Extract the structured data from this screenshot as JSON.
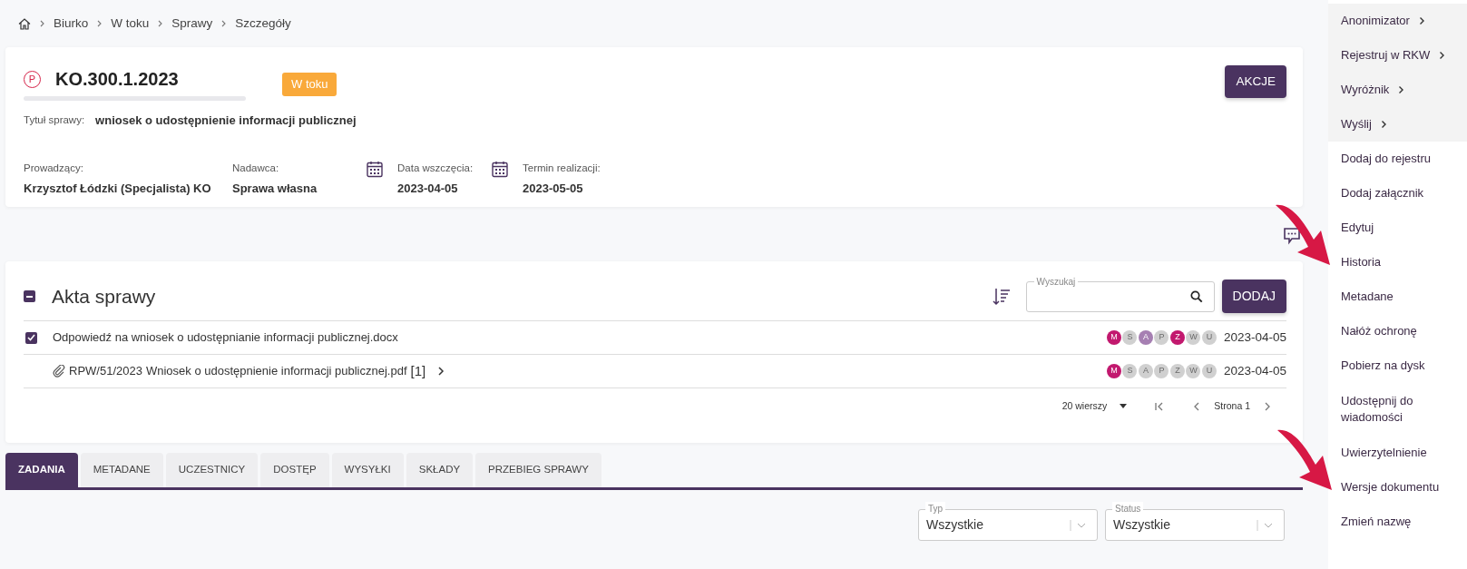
{
  "breadcrumb": [
    "Biurko",
    "W toku",
    "Sprawy",
    "Szczegóły"
  ],
  "case": {
    "badge": "P",
    "number": "KO.300.1.2023",
    "status": "W toku",
    "action_button": "AKCJE",
    "title_label": "Tytuł sprawy:",
    "title": "wniosek o udostępnienie informacji publicznej",
    "fields": [
      {
        "label": "Prowadzący:",
        "value": "Krzysztof Łódzki (Specjalista) KO",
        "kind": "text"
      },
      {
        "label": "Nadawca:",
        "value": "Sprawa własna",
        "kind": "text"
      },
      {
        "label": "Data wszczęcia:",
        "value": "2023-04-05",
        "kind": "date"
      },
      {
        "label": "Termin realizacji:",
        "value": "2023-05-05",
        "kind": "date"
      }
    ]
  },
  "files": {
    "title": "Akta sprawy",
    "search_label": "Wyszukaj",
    "add_button": "DODAJ",
    "rows": [
      {
        "name": "Odpowiedź na wniosek o udostępnianie informacji publicznej.docx",
        "checked": true,
        "attachment": false,
        "date": "2023-04-05",
        "flags": [
          {
            "letter": "M",
            "color": "#c2186e"
          },
          {
            "letter": "S",
            "color": "#d0d0d0"
          },
          {
            "letter": "A",
            "color": "#a67fb2"
          },
          {
            "letter": "P",
            "color": "#d0d0d0"
          },
          {
            "letter": "Z",
            "color": "#c2186e"
          },
          {
            "letter": "W",
            "color": "#d0d0d0"
          },
          {
            "letter": "U",
            "color": "#d0d0d0"
          }
        ]
      },
      {
        "prefix": "RPW/51/2023",
        "name": "Wniosek o udostępnienie informacji publicznej.pdf",
        "count": "[1]",
        "checked": false,
        "attachment": true,
        "date": "2023-04-05",
        "flags": [
          {
            "letter": "M",
            "color": "#c2186e"
          },
          {
            "letter": "S",
            "color": "#d0d0d0"
          },
          {
            "letter": "A",
            "color": "#d0d0d0"
          },
          {
            "letter": "P",
            "color": "#d0d0d0"
          },
          {
            "letter": "Z",
            "color": "#d0d0d0"
          },
          {
            "letter": "W",
            "color": "#d0d0d0"
          },
          {
            "letter": "U",
            "color": "#d0d0d0"
          }
        ]
      }
    ],
    "rows_per_page": "20 wierszy",
    "page": "Strona 1"
  },
  "tabs": [
    {
      "label": "ZADANIA",
      "selected": true
    },
    {
      "label": "METADANE",
      "selected": false
    },
    {
      "label": "UCZESTNICY",
      "selected": false
    },
    {
      "label": "DOSTĘP",
      "selected": false
    },
    {
      "label": "WYSYŁKI",
      "selected": false
    },
    {
      "label": "SKŁADY",
      "selected": false
    },
    {
      "label": "PRZEBIEG SPRAWY",
      "selected": false
    }
  ],
  "filters": [
    {
      "label": "Typ",
      "value": "Wszystkie"
    },
    {
      "label": "Status",
      "value": "Wszystkie"
    }
  ],
  "menu": [
    {
      "label": "Anonimizator",
      "submenu": true
    },
    {
      "label": "Rejestruj w RKW",
      "submenu": true
    },
    {
      "label": "Wyróżnik",
      "submenu": true
    },
    {
      "label": "Wyślij",
      "submenu": true
    },
    {
      "label": "Dodaj do rejestru",
      "submenu": false
    },
    {
      "label": "Dodaj załącznik",
      "submenu": false
    },
    {
      "label": "Edytuj",
      "submenu": false
    },
    {
      "label": "Historia",
      "submenu": false
    },
    {
      "label": "Metadane",
      "submenu": false
    },
    {
      "label": "Nałóż ochronę",
      "submenu": false
    },
    {
      "label": "Pobierz na dysk",
      "submenu": false
    },
    {
      "label": "Udostępnij do wiadomości",
      "submenu": false
    },
    {
      "label": "Uwierzytelnienie",
      "submenu": false
    },
    {
      "label": "Wersje dokumentu",
      "submenu": false
    },
    {
      "label": "Zmień nazwę",
      "submenu": false
    }
  ]
}
